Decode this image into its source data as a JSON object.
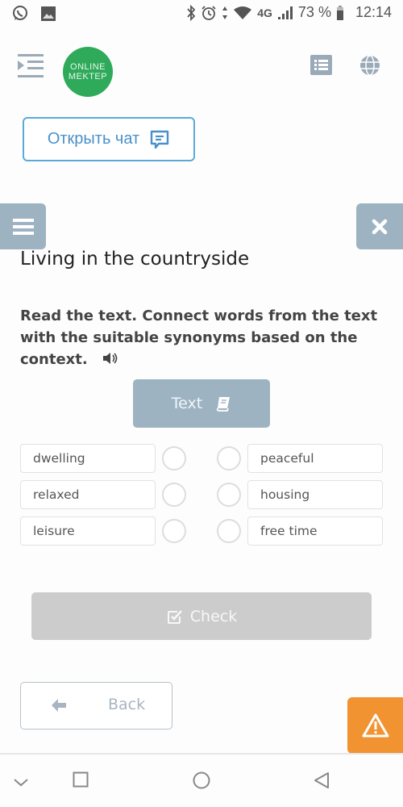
{
  "status_bar": {
    "left_icons": [
      "whatsapp-icon",
      "image-icon"
    ],
    "right_icons": [
      "bluetooth-icon",
      "alarm-icon",
      "data-transfer-icon",
      "wifi-icon"
    ],
    "network": "4G",
    "battery_percent": "73 %",
    "time": "12:14"
  },
  "header": {
    "logo_line1": "ONLINE",
    "logo_line2": "MEKTEP",
    "brand_color": "#2eaa5a"
  },
  "chat_button": {
    "label": "Открыть чат"
  },
  "lesson": {
    "title": "Living in the countryside",
    "instruction": "Read the text. Connect words from the text with the suitable synonyms based on the context.",
    "text_button_label": "Text"
  },
  "matching": {
    "left": [
      {
        "label": "dwelling"
      },
      {
        "label": "relaxed"
      },
      {
        "label": "leisure"
      }
    ],
    "right": [
      {
        "label": "peaceful"
      },
      {
        "label": "housing"
      },
      {
        "label": "free time"
      }
    ]
  },
  "actions": {
    "check_label": "Check",
    "back_label": "Back"
  },
  "colors": {
    "accent_blue": "#5aa9dc",
    "side_button": "#9eb3c2",
    "warning": "#f29332",
    "disabled": "#cccccc"
  }
}
